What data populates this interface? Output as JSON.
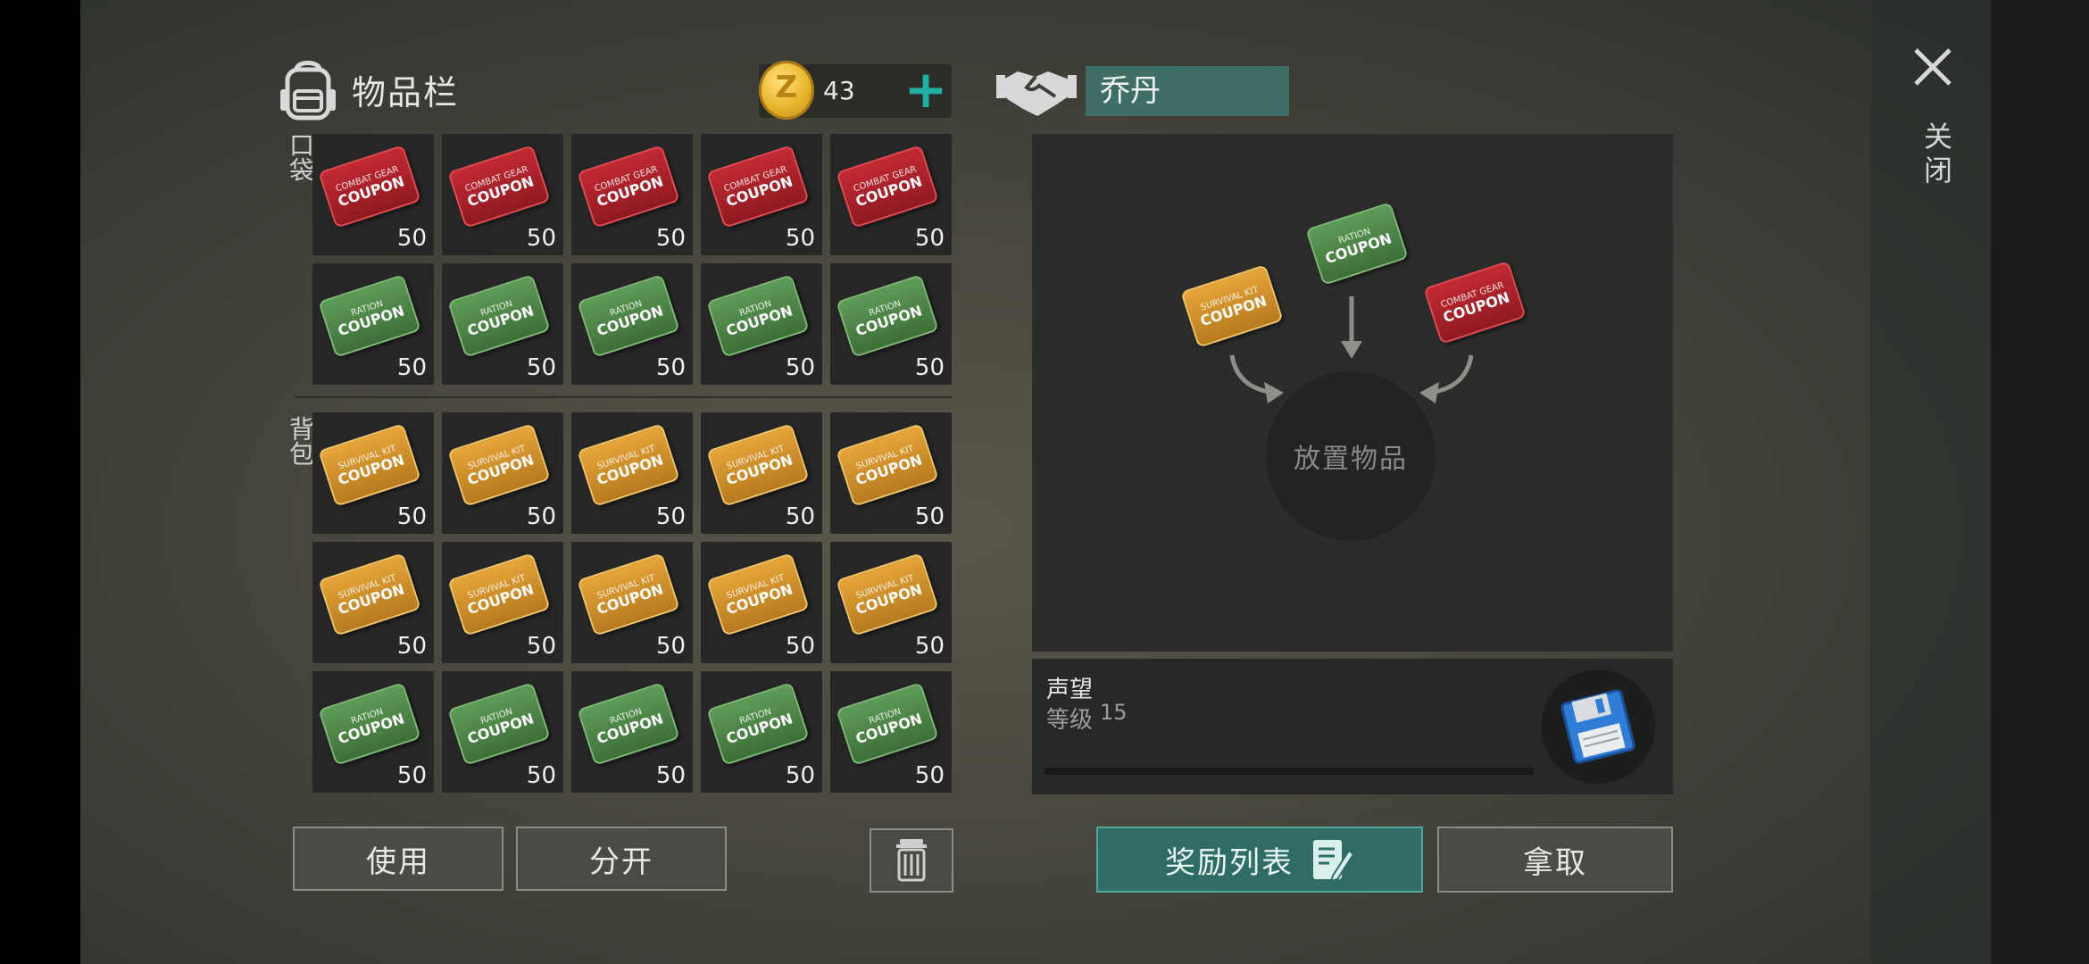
{
  "inventory": {
    "title": "物品栏",
    "pocket_label": "口袋",
    "backpack_label": "背包",
    "coins": "43",
    "pocket_slots": [
      {
        "type": "red",
        "line1": "COMBAT GEAR",
        "line2": "COUPON",
        "count": "50"
      },
      {
        "type": "red",
        "line1": "COMBAT GEAR",
        "line2": "COUPON",
        "count": "50"
      },
      {
        "type": "red",
        "line1": "COMBAT GEAR",
        "line2": "COUPON",
        "count": "50"
      },
      {
        "type": "red",
        "line1": "COMBAT GEAR",
        "line2": "COUPON",
        "count": "50"
      },
      {
        "type": "red",
        "line1": "COMBAT GEAR",
        "line2": "COUPON",
        "count": "50"
      },
      {
        "type": "green",
        "line1": "RATION",
        "line2": "COUPON",
        "count": "50"
      },
      {
        "type": "green",
        "line1": "RATION",
        "line2": "COUPON",
        "count": "50"
      },
      {
        "type": "green",
        "line1": "RATION",
        "line2": "COUPON",
        "count": "50"
      },
      {
        "type": "green",
        "line1": "RATION",
        "line2": "COUPON",
        "count": "50"
      },
      {
        "type": "green",
        "line1": "RATION",
        "line2": "COUPON",
        "count": "50"
      }
    ],
    "backpack_slots": [
      {
        "type": "gold",
        "line1": "SURVIVAL KIT",
        "line2": "COUPON",
        "count": "50"
      },
      {
        "type": "gold",
        "line1": "SURVIVAL KIT",
        "line2": "COUPON",
        "count": "50"
      },
      {
        "type": "gold",
        "line1": "SURVIVAL KIT",
        "line2": "COUPON",
        "count": "50"
      },
      {
        "type": "gold",
        "line1": "SURVIVAL KIT",
        "line2": "COUPON",
        "count": "50"
      },
      {
        "type": "gold",
        "line1": "SURVIVAL KIT",
        "line2": "COUPON",
        "count": "50"
      },
      {
        "type": "gold",
        "line1": "SURVIVAL KIT",
        "line2": "COUPON",
        "count": "50"
      },
      {
        "type": "gold",
        "line1": "SURVIVAL KIT",
        "line2": "COUPON",
        "count": "50"
      },
      {
        "type": "gold",
        "line1": "SURVIVAL KIT",
        "line2": "COUPON",
        "count": "50"
      },
      {
        "type": "gold",
        "line1": "SURVIVAL KIT",
        "line2": "COUPON",
        "count": "50"
      },
      {
        "type": "gold",
        "line1": "SURVIVAL KIT",
        "line2": "COUPON",
        "count": "50"
      },
      {
        "type": "green",
        "line1": "RATION",
        "line2": "COUPON",
        "count": "50"
      },
      {
        "type": "green",
        "line1": "RATION",
        "line2": "COUPON",
        "count": "50"
      },
      {
        "type": "green",
        "line1": "RATION",
        "line2": "COUPON",
        "count": "50"
      },
      {
        "type": "green",
        "line1": "RATION",
        "line2": "COUPON",
        "count": "50"
      },
      {
        "type": "green",
        "line1": "RATION",
        "line2": "COUPON",
        "count": "50"
      }
    ],
    "use_label": "使用",
    "split_label": "分开"
  },
  "trader": {
    "name": "乔丹",
    "drop_label": "放置物品",
    "drop_coupons": [
      {
        "type": "gold",
        "line1": "SURVIVAL KIT",
        "line2": "COUPON"
      },
      {
        "type": "green",
        "line1": "RATION",
        "line2": "COUPON"
      },
      {
        "type": "red",
        "line1": "COMBAT GEAR",
        "line2": "COUPON"
      }
    ],
    "reputation_title": "声望",
    "level_label": "等级",
    "level_value": "15",
    "reward_list_label": "奖励列表",
    "take_label": "拿取"
  },
  "close_label": "关闭",
  "icons": {
    "backpack": "backpack-icon",
    "coin": "coin-icon",
    "plus": "plus-icon",
    "handshake": "handshake-icon",
    "trash": "trash-icon",
    "floppy": "floppy-disk-icon",
    "edit": "edit-list-icon",
    "close": "close-icon"
  },
  "colors": {
    "accent": "#1fb2a4",
    "trader_name_bg": "#3f6e67",
    "reward_btn_bg": "#2f6c66"
  }
}
